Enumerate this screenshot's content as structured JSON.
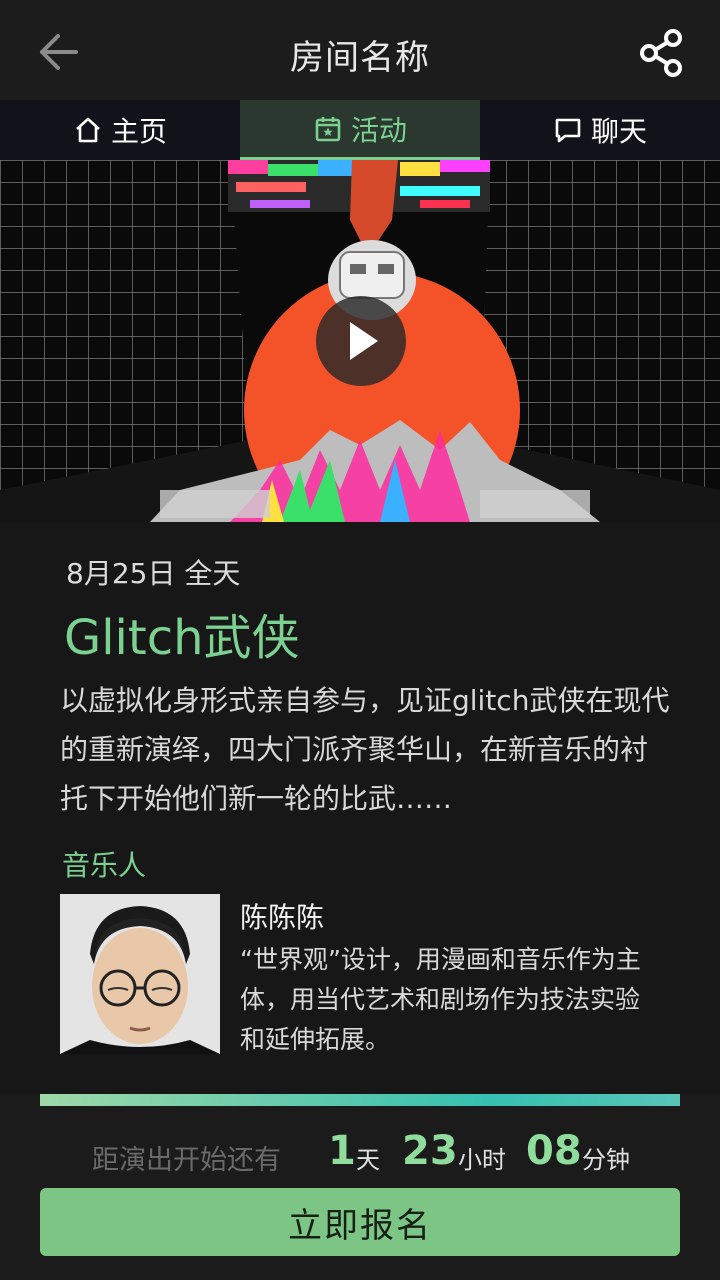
{
  "header": {
    "title": "房间名称",
    "back_icon": "arrow-left-icon",
    "share_icon": "share-icon"
  },
  "tabs": [
    {
      "label": "主页",
      "icon": "home-icon",
      "active": false
    },
    {
      "label": "活动",
      "icon": "calendar-star-icon",
      "active": true
    },
    {
      "label": "聊天",
      "icon": "chat-bubble-icon",
      "active": false
    }
  ],
  "hero": {
    "play_icon": "play-icon"
  },
  "event": {
    "date": "8月25日 全天",
    "title": "Glitch武侠",
    "description": "以虚拟化身形式亲自参与，见证glitch武侠在现代的重新演绎，四大门派齐聚华山，在新音乐的衬托下开始他们新一轮的比武……"
  },
  "musicians": {
    "section_label": "音乐人",
    "person": {
      "name": "陈陈陈",
      "bio": "“世界观”设计，用漫画和音乐作为主体，用当代艺术和剧场作为技法实验和延伸拓展。"
    }
  },
  "countdown": {
    "label": "距演出开始还有",
    "days": "1",
    "days_unit": "天",
    "hours": "23",
    "hours_unit": "小时",
    "minutes": "08",
    "minutes_unit": "分钟"
  },
  "signup": {
    "label": "立即报名"
  },
  "colors": {
    "accent": "#7cd090",
    "button": "#7cc584",
    "background": "#171717"
  }
}
